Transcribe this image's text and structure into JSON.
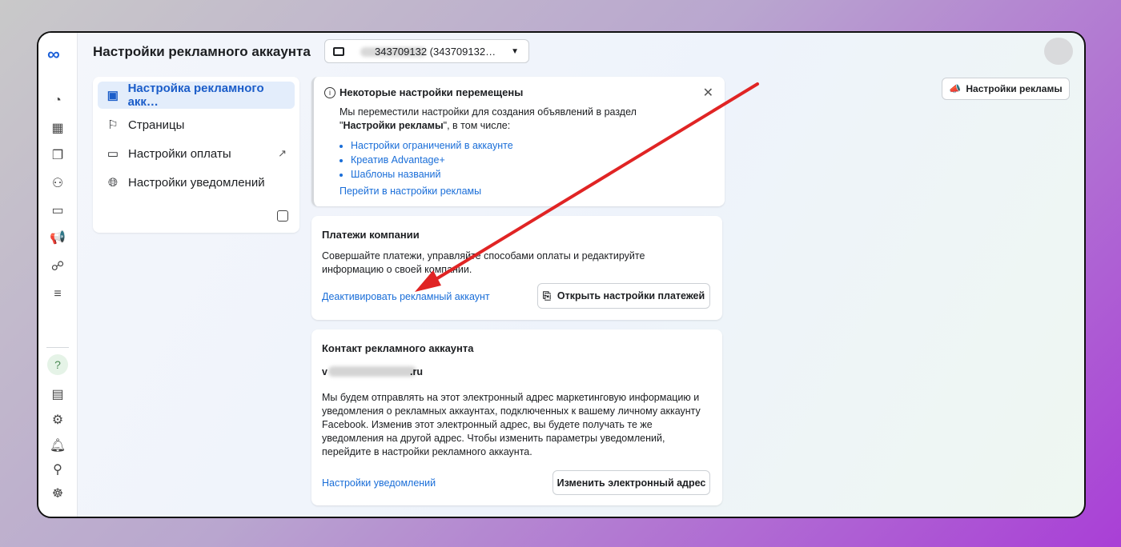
{
  "header": {
    "title": "Настройки рекламного аккаунта",
    "account_selector": "343709132 (343709132…",
    "account_visible_tail": "3 235 (343709132…",
    "ad_settings_button": "Настройки рекламы"
  },
  "left_nav": {
    "items": [
      {
        "label": "Настройка рекламного акк…",
        "icon": "ad-account-icon",
        "active": true
      },
      {
        "label": "Страницы",
        "icon": "flag-icon"
      },
      {
        "label": "Настройки оплаты",
        "icon": "credit-card-icon",
        "external": true
      },
      {
        "label": "Настройки уведомлений",
        "icon": "globe-icon"
      }
    ]
  },
  "notice": {
    "title": "Некоторые настройки перемещены",
    "body_prefix": "Мы переместили настройки для создания объявлений в раздел \"",
    "body_bold": "Настройки рекламы",
    "body_suffix": "\", в том числе:",
    "links": [
      "Настройки ограничений в аккаунте",
      "Креатив Advantage+",
      "Шаблоны названий"
    ],
    "goto_link": "Перейти в настройки рекламы"
  },
  "payments": {
    "title": "Платежи компании",
    "text": "Совершайте платежи, управляйте способами оплаты и редактируйте информацию о своей компании.",
    "deactivate_link": "Деактивировать рекламный аккаунт",
    "open_button": "Открыть настройки платежей"
  },
  "contact": {
    "title": "Контакт рекламного аккаунта",
    "email_tail": ".ru",
    "email_head": "v",
    "text": "Мы будем отправлять на этот электронный адрес маркетинговую информацию и уведомления о рекламных аккаунтах, подключенных к вашему личному аккаунту Facebook. Изменив этот электронный адрес, вы будете получать те же уведомления на другой адрес. Чтобы изменить параметры уведомлений, перейдите в настройки рекламного аккаунта.",
    "notif_link": "Настройки уведомлений",
    "change_button": "Изменить электронный адрес"
  },
  "colors": {
    "accent": "#1a6ed8",
    "arrow": "#e02424"
  }
}
